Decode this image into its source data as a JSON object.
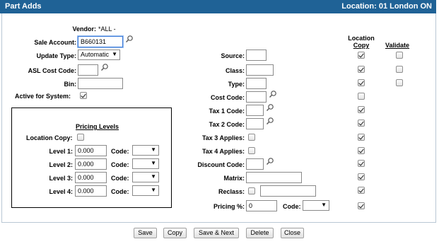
{
  "title": "Part Adds",
  "location_label": "Location:  01 London ON",
  "vendor": {
    "label": "Vendor:",
    "value": "*ALL -"
  },
  "sale_account": {
    "label": "Sale Account:",
    "value": "B660131"
  },
  "update_type": {
    "label": "Update Type:",
    "value": "Automatic"
  },
  "asl_cost_code": {
    "label": "ASL Cost Code:",
    "value": ""
  },
  "bin": {
    "label": "Bin:",
    "value": ""
  },
  "active_for_system": {
    "label": "Active for System:",
    "checked": true
  },
  "pricing": {
    "heading": "Pricing Levels",
    "location_copy_label": "Location Copy:",
    "code_label": "Code:",
    "levels": [
      {
        "label": "Level 1:",
        "value": "0.000"
      },
      {
        "label": "Level 2:",
        "value": "0.000"
      },
      {
        "label": "Level 3:",
        "value": "0.000"
      },
      {
        "label": "Level 4:",
        "value": "0.000"
      }
    ]
  },
  "headers": {
    "location_copy_1": "Location",
    "location_copy_2": "Copy",
    "validate": "Validate"
  },
  "right_fields": [
    {
      "label": "Source:",
      "value": "",
      "copy": true,
      "validate": false
    },
    {
      "label": "Class:",
      "value": "",
      "copy": true,
      "validate": false
    },
    {
      "label": "Type:",
      "value": "",
      "copy": true,
      "validate": false
    },
    {
      "label": "Cost Code:",
      "value": "",
      "copy": false
    },
    {
      "label": "Tax 1 Code:",
      "value": "",
      "copy": true
    },
    {
      "label": "Tax 2 Code:",
      "value": "",
      "copy": true
    },
    {
      "label": "Tax 3 Applies:",
      "copy": true
    },
    {
      "label": "Tax 4 Applies:",
      "copy": true
    },
    {
      "label": "Discount Code:",
      "value": "",
      "copy": true
    },
    {
      "label": "Matrix:",
      "value": "",
      "copy": true
    },
    {
      "label": "Reclass:",
      "value": "",
      "copy": true
    },
    {
      "label": "Pricing %:",
      "value": "0",
      "code_label": "Code:",
      "copy": true
    }
  ],
  "buttons": {
    "save": "Save",
    "copy": "Copy",
    "save_next": "Save & Next",
    "delete": "Delete",
    "close": "Close"
  },
  "colors": {
    "title_bar": "#1f6296",
    "panel_border": "#b9c7d4"
  },
  "icons": {
    "lookup": "magnifier-icon",
    "dropdown": "triangle-down-icon"
  }
}
